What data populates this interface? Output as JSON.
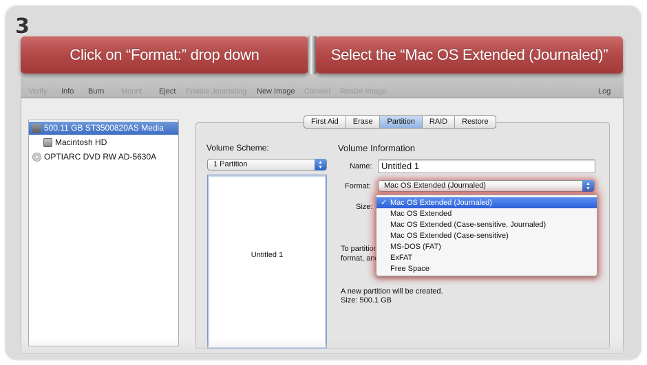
{
  "step": {
    "number": "3"
  },
  "banners": {
    "left": "Click on “Format:” drop down",
    "right": "Select the “Mac OS Extended (Journaled)”"
  },
  "toolbar": {
    "items": [
      "Verify",
      "Info",
      "Burn",
      "Mount",
      "Eject",
      "Enable Journaling",
      "New Image",
      "Convert",
      "Resize Image",
      "Log"
    ]
  },
  "sidebar": {
    "items": [
      {
        "label": "500.11 GB ST3500820AS Media",
        "icon": "hard-disk-icon",
        "selected": true
      },
      {
        "label": "Macintosh HD",
        "icon": "volume-icon",
        "selected": false
      },
      {
        "label": "OPTIARC DVD RW AD-5630A",
        "icon": "dvd-drive-icon",
        "selected": false
      }
    ]
  },
  "tabs": [
    "First Aid",
    "Erase",
    "Partition",
    "RAID",
    "Restore"
  ],
  "active_tab": "Partition",
  "volume_scheme": {
    "label": "Volume Scheme:",
    "value": "1 Partition",
    "partition_name": "Untitled 1"
  },
  "volume_info": {
    "heading": "Volume Information",
    "name_label": "Name:",
    "name_value": "Untitled 1",
    "format_label": "Format:",
    "format_value": "Mac OS Extended (Journaled)",
    "size_label": "Size:",
    "hint_line1": "To partition",
    "hint_line2": "format, and",
    "status_line1": "A new partition will be created.",
    "status_line2": "Size: 500.1 GB"
  },
  "format_menu": {
    "options": [
      "Mac OS Extended (Journaled)",
      "Mac OS Extended",
      "Mac OS Extended (Case-sensitive, Journaled)",
      "Mac OS Extended (Case-sensitive)",
      "MS-DOS (FAT)",
      "ExFAT",
      "Free Space"
    ],
    "selected": "Mac OS Extended (Journaled)",
    "check": "✓"
  },
  "colors": {
    "banner": "#b44a4a",
    "selection": "#3d6fc3",
    "highlight_glow": "#c83c3c"
  }
}
